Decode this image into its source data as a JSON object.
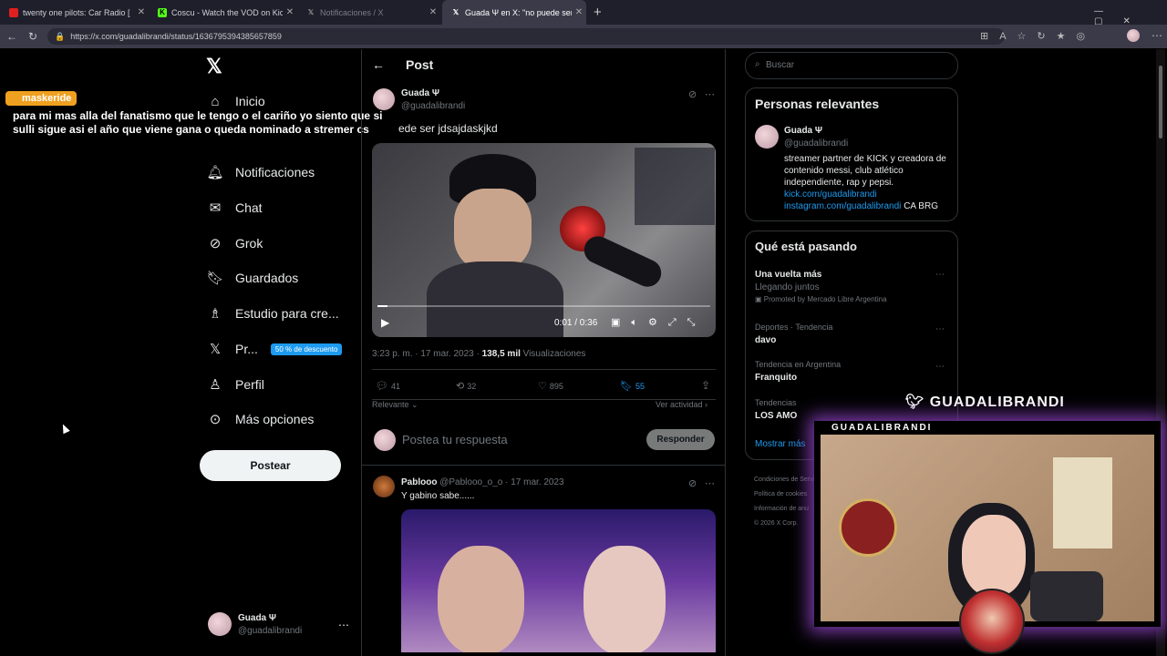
{
  "browser": {
    "tabs": [
      {
        "title": "twenty one pilots: Car Radio [",
        "favicon_color": "#e02020"
      },
      {
        "title": "Coscu - Watch the VOD on Kick",
        "favicon_color": "#53fc18",
        "favicon_letter": "K"
      },
      {
        "title": "Notificaciones / X",
        "favicon_color": "#333333",
        "favicon_letter": "𝕏"
      },
      {
        "title": "Guada Ψ en X: \"no puede ser jdsaj",
        "favicon_color": "#333333",
        "favicon_letter": "𝕏"
      }
    ],
    "url": "https://x.com/guadalibrandi/status/1636795394385657859"
  },
  "stream_overlay": {
    "chat_user": "maskeride",
    "chat_message": "para mi mas alla del fanatismo que le tengo o el cariño yo siento que si sulli sigue asi el año que viene gana o queda nominado a stremer cs",
    "twitter_handle": "GUADALIBRANDI",
    "webcam_label": "GUADALIBRANDI"
  },
  "sidebar": {
    "items": [
      {
        "label": "Inicio",
        "icon": "home-icon"
      },
      {
        "label": "Notificaciones",
        "icon": "bell-icon"
      },
      {
        "label": "Chat",
        "icon": "mail-icon"
      },
      {
        "label": "Grok",
        "icon": "grok-icon"
      },
      {
        "label": "Guardados",
        "icon": "bookmark-icon"
      },
      {
        "label": "Estudio para cre...",
        "icon": "studio-icon"
      },
      {
        "label": "Pr...",
        "icon": "x-logo-icon",
        "badge": "50 % de descuento"
      },
      {
        "label": "Perfil",
        "icon": "person-icon"
      },
      {
        "label": "Más opciones",
        "icon": "more-icon"
      }
    ],
    "post_button": "Postear",
    "account": {
      "name": "Guada Ψ",
      "handle": "@guadalibrandi"
    }
  },
  "post": {
    "header": "Post",
    "author_name": "Guada Ψ",
    "author_handle": "@guadalibrandi",
    "text": "ede ser jdsajdaskjkd",
    "video_time": "0:01 / 0:36",
    "video_progress": 0.03,
    "timestamp": "3:23 p. m. · 17 mar. 2023 ·",
    "views_count": "138,5 mil",
    "views_label": "Visualizaciones",
    "stats": {
      "replies": "41",
      "reposts": "32",
      "likes": "895",
      "bookmarks": "55"
    },
    "sort_label": "Relevante",
    "activity_label": "Ver actividad",
    "reply_placeholder": "Postea tu respuesta",
    "reply_button": "Responder"
  },
  "reply": {
    "author_name": "Pablooo",
    "author_handle": "@Pablooo_o_o",
    "date": "· 17 mar. 2023",
    "text": "Y gabino sabe......"
  },
  "right": {
    "search_placeholder": "Buscar",
    "relevant_title": "Personas relevantes",
    "person": {
      "name": "Guada Ψ",
      "handle": "@guadalibrandi",
      "bio": "streamer partner de KICK y creadora de contenido messi, club atlético independiente, rap y pepsi.",
      "link1": "kick.com/guadalibrandi",
      "link2": "instagram.com/guadalibrandi",
      "suffix": "CA BRG"
    },
    "trends_title": "Qué está pasando",
    "trends": [
      {
        "category": "",
        "name": "Una vuelta más",
        "sub": "Llegando juntos",
        "promo": "Promoted by Mercado Libre Argentina"
      },
      {
        "category": "Deportes · Tendencia",
        "name": "davo"
      },
      {
        "category": "Tendencia en Argentina",
        "name": "Franquito"
      },
      {
        "category": "Tendencias",
        "name": "LOS AMO"
      }
    ],
    "show_more": "Mostrar más",
    "footer": [
      "Condiciones de Servicio",
      "Política de cookies",
      "Información de anu",
      "© 2026 X Corp."
    ]
  },
  "colors": {
    "accent": "#1d9bf0",
    "bg": "#000000",
    "border": "#2f3336"
  }
}
